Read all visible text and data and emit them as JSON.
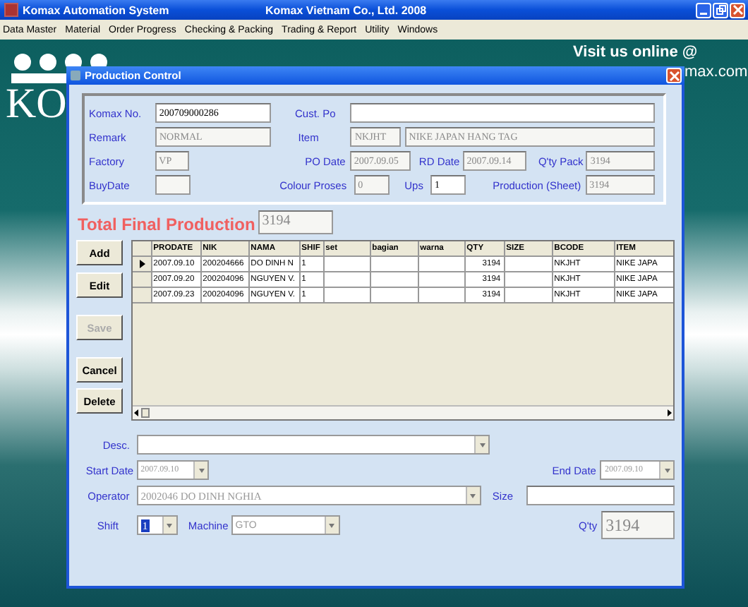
{
  "app": {
    "title": "Komax Automation System",
    "company": "Komax Vietnam Co., Ltd.  2008"
  },
  "menu": [
    "Data Master",
    "Material",
    "Order Progress",
    "Checking & Packing",
    "Trading & Report",
    "Utility",
    "Windows"
  ],
  "background": {
    "logo_text": "KO",
    "slogan": "Visit us online @",
    "url_fragment": "max.com"
  },
  "dialog": {
    "title": "Production Control",
    "form": {
      "komax_no": {
        "label": "Komax No.",
        "value": "200709000286",
        "disabled": false
      },
      "cust_po": {
        "label": "Cust. Po",
        "disabled": false
      },
      "remark": {
        "label": "Remark",
        "value": "NORMAL",
        "disabled": true
      },
      "item": {
        "label": "Item",
        "code": "NKJHT",
        "name": "NIKE JAPAN HANG TAG",
        "disabled": true
      },
      "factory": {
        "label": "Factory",
        "value": "VP",
        "disabled": true
      },
      "po_date": {
        "label": "PO Date",
        "value": "2007.09.05",
        "disabled": true
      },
      "rd_date": {
        "label": "RD Date",
        "value": "2007.09.14",
        "disabled": true
      },
      "qty_pack": {
        "label": "Q'ty Pack",
        "value": "3194",
        "disabled": true
      },
      "buy_date": {
        "label": "BuyDate",
        "disabled": true
      },
      "colour_proses": {
        "label": "Colour Proses",
        "value": "0",
        "disabled": true
      },
      "ups": {
        "label": "Ups",
        "value": "1",
        "disabled": false
      },
      "production_sheet": {
        "label": "Production (Sheet)",
        "value": "3194",
        "disabled": true
      }
    },
    "total": {
      "label": "Total Final Production",
      "value": "3194"
    },
    "buttons": [
      {
        "label": "Add",
        "disabled": false
      },
      {
        "label": "Edit",
        "disabled": false
      },
      {
        "label": "Save",
        "disabled": true
      },
      {
        "label": "Cancel",
        "disabled": false
      },
      {
        "label": "Delete",
        "disabled": false
      }
    ],
    "grid": {
      "columns": [
        "PRODATE",
        "NIK",
        "NAMA",
        "SHIF",
        "set",
        "bagian",
        "warna",
        "QTY",
        "SIZE",
        "BCODE",
        "ITEM"
      ],
      "rows": [
        {
          "selected": true,
          "cells": [
            "2007.09.10",
            "200204666",
            "DO DINH N",
            "1",
            "",
            "",
            "",
            "3194",
            "",
            "NKJHT",
            "NIKE JAPA"
          ]
        },
        {
          "selected": false,
          "cells": [
            "2007.09.20",
            "200204096",
            "NGUYEN V.",
            "1",
            "",
            "",
            "",
            "3194",
            "",
            "NKJHT",
            "NIKE JAPA"
          ]
        },
        {
          "selected": false,
          "cells": [
            "2007.09.23",
            "200204096",
            "NGUYEN V.",
            "1",
            "",
            "",
            "",
            "3194",
            "",
            "NKJHT",
            "NIKE JAPA"
          ]
        }
      ]
    },
    "bottom": {
      "desc": {
        "label": "Desc."
      },
      "start_date": {
        "label": "Start Date",
        "value": "2007.09.10",
        "disabled": true
      },
      "end_date": {
        "label": "End Date",
        "value": "2007.09.10",
        "disabled": true
      },
      "operator": {
        "label": "Operator",
        "value": "2002046 DO DINH NGHIA",
        "disabled": true
      },
      "size": {
        "label": "Size"
      },
      "shift": {
        "label": "Shift",
        "value": "1",
        "selected": true
      },
      "machine": {
        "label": "Machine",
        "value": "GTO",
        "disabled": true
      },
      "qty": {
        "label": "Q'ty",
        "value": "3194",
        "disabled": true
      }
    }
  }
}
